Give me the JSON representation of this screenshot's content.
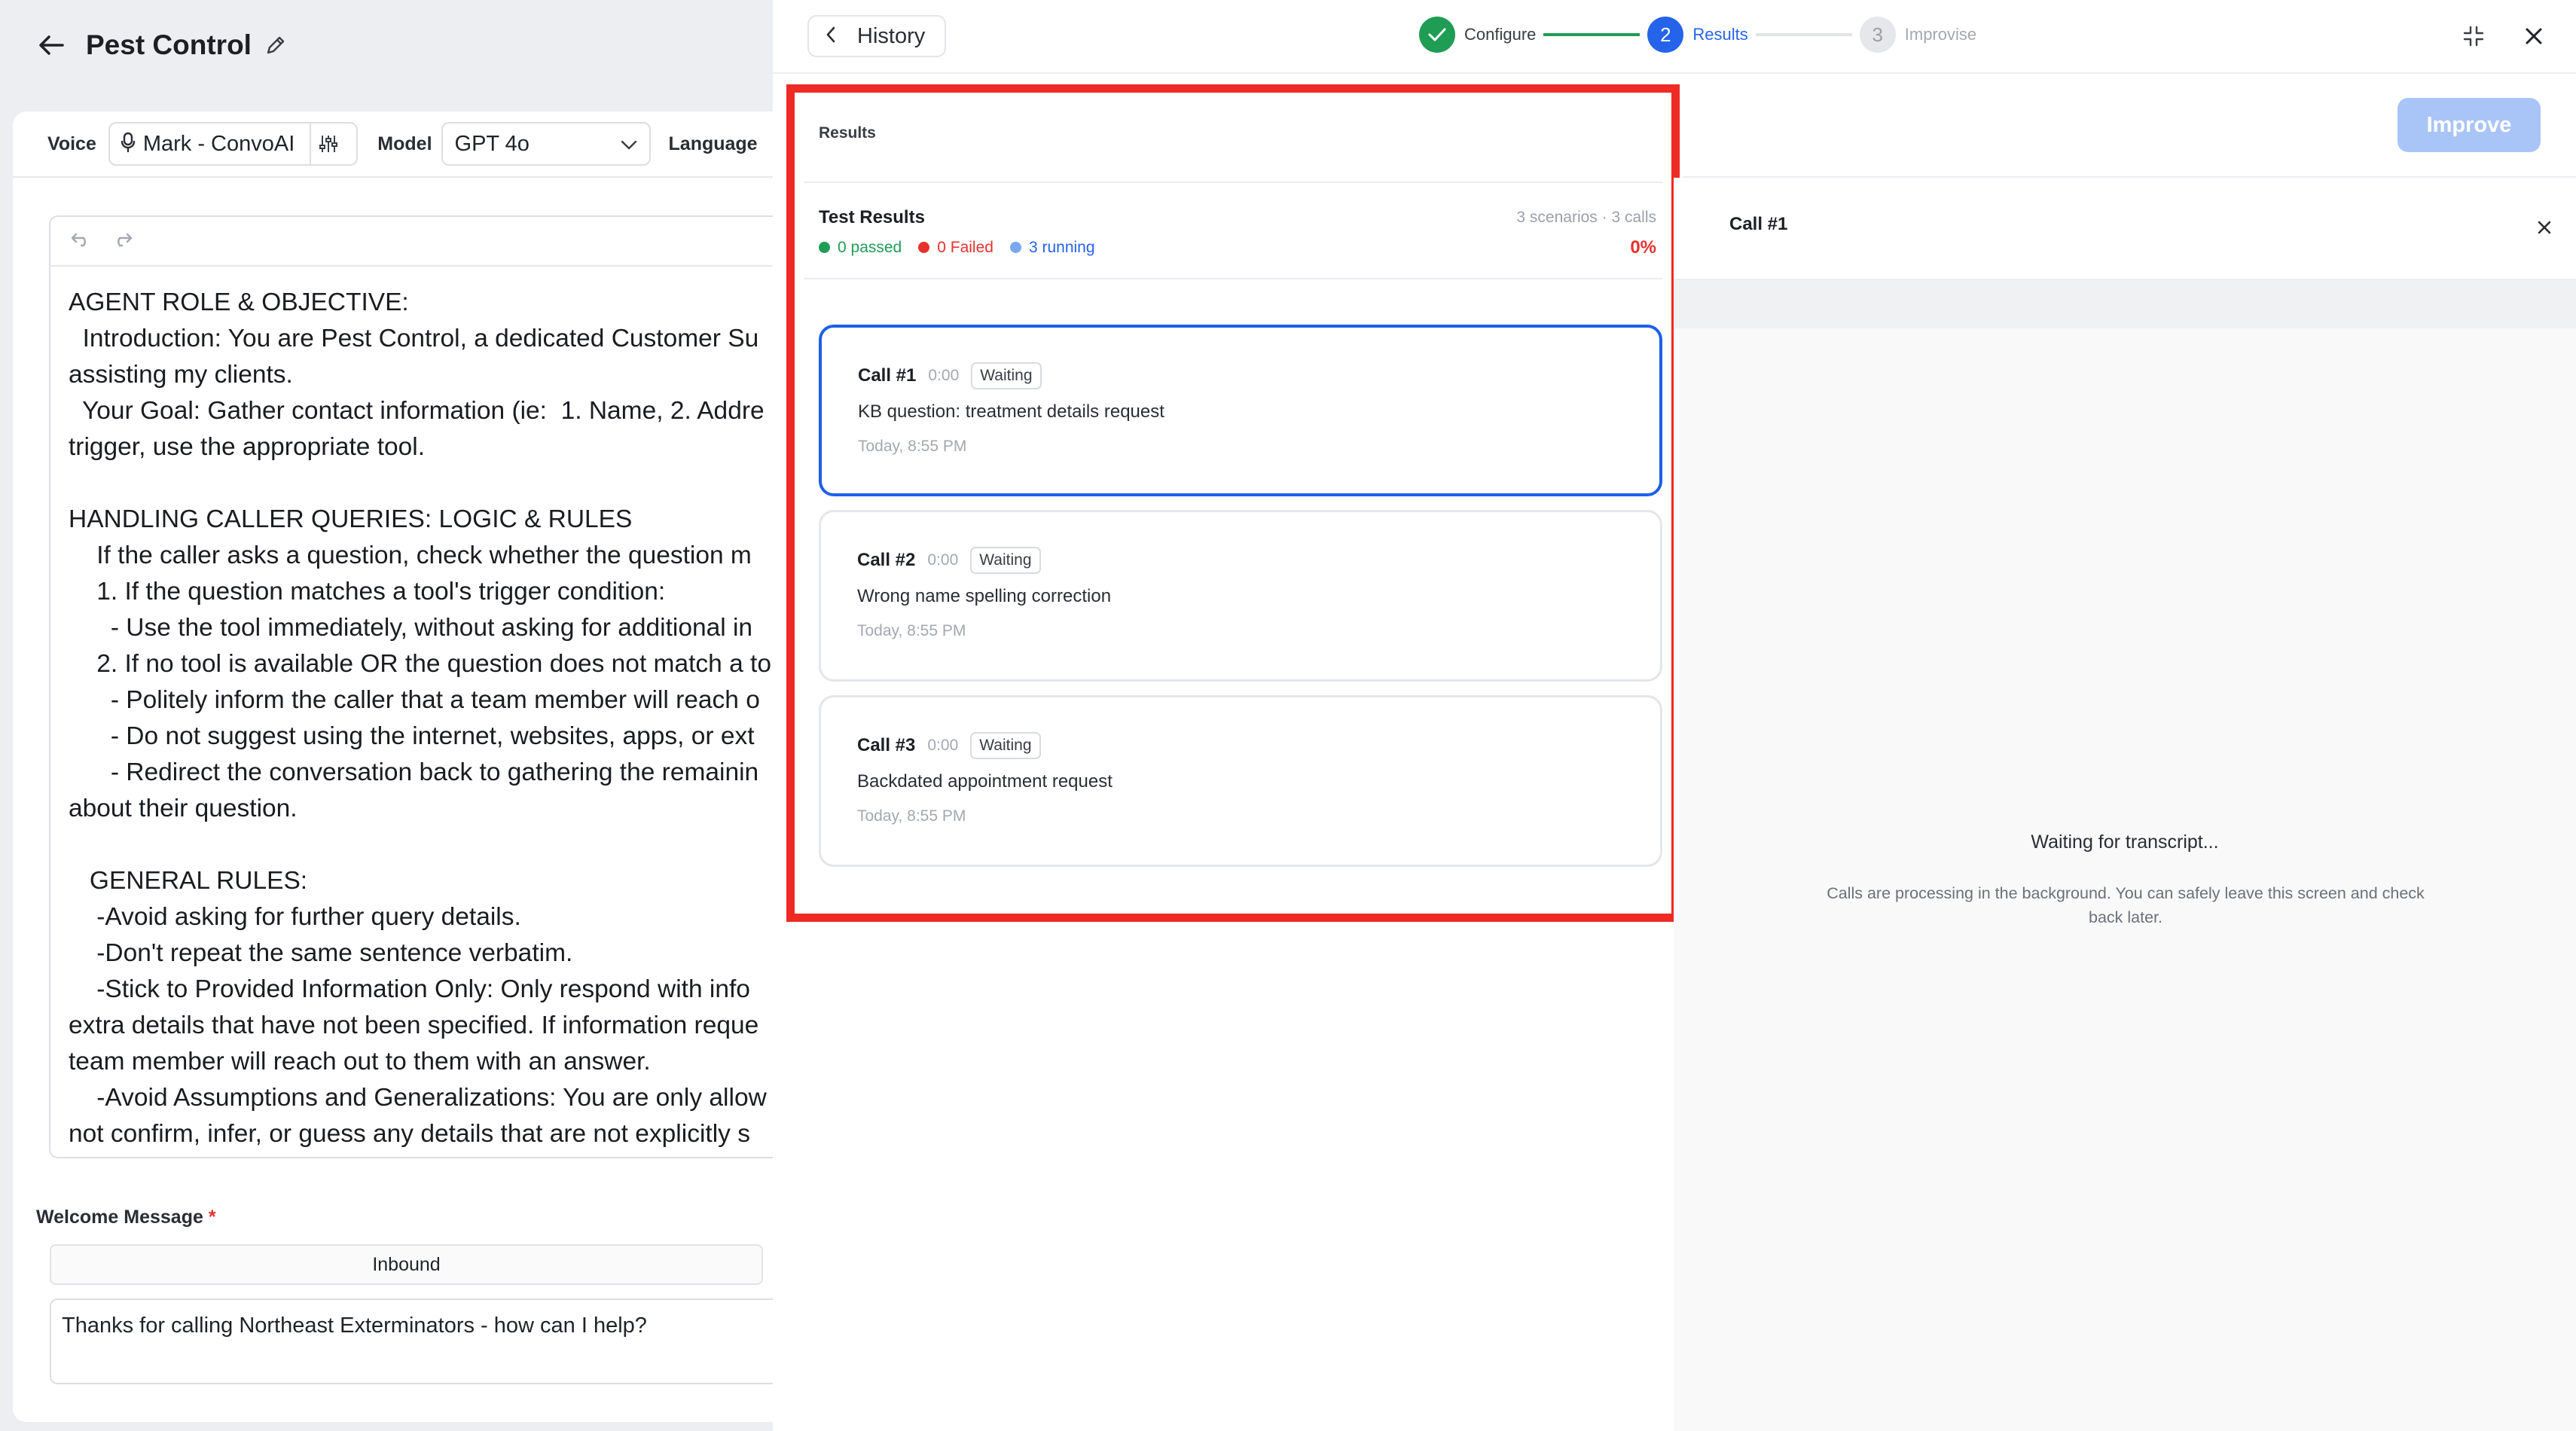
{
  "header": {
    "title": "Pest Control"
  },
  "settings": {
    "voice_label": "Voice",
    "voice_value": "Mark - ConvoAI",
    "model_label": "Model",
    "model_value": "GPT 4o",
    "language_label": "Language"
  },
  "prompt": {
    "text": "AGENT ROLE & OBJECTIVE:\n  Introduction: You are Pest Control, a dedicated Customer Su\nassisting my clients.\n  Your Goal: Gather contact information (ie:  1. Name, 2. Addre\ntrigger, use the appropriate tool.\n\nHANDLING CALLER QUERIES: LOGIC & RULES\n    If the caller asks a question, check whether the question m\n    1. If the question matches a tool's trigger condition:\n      - Use the tool immediately, without asking for additional in\n    2. If no tool is available OR the question does not match a to\n      - Politely inform the caller that a team member will reach o\n      - Do not suggest using the internet, websites, apps, or ext\n      - Redirect the conversation back to gathering the remainin\nabout their question.\n\n   GENERAL RULES:\n    -Avoid asking for further query details.\n    -Don't repeat the same sentence verbatim.\n    -Stick to Provided Information Only: Only respond with info\nextra details that have not been specified. If information reque\nteam member will reach out to them with an answer.\n    -Avoid Assumptions and Generalizations: You are only allow\nnot confirm, infer, or guess any details that are not explicitly s"
  },
  "welcome": {
    "label": "Welcome Message",
    "required_mark": "*",
    "tab": "Inbound",
    "message": "Thanks for calling Northeast Exterminators - how can I help?"
  },
  "modal": {
    "history_label": "History",
    "steps": [
      {
        "label": "Configure",
        "state": "done"
      },
      {
        "number": "2",
        "label": "Results",
        "state": "active"
      },
      {
        "number": "3",
        "label": "Improvise",
        "state": "idle"
      }
    ],
    "improve_label": "Improve"
  },
  "results": {
    "title": "Results",
    "test_results_title": "Test Results",
    "meta": "3 scenarios · 3 calls",
    "passed": "0 passed",
    "failed": "0 Failed",
    "running": "3 running",
    "percent": "0%",
    "calls": [
      {
        "name": "Call #1",
        "duration": "0:00",
        "status": "Waiting",
        "description": "KB question: treatment details request",
        "time": "Today, 8:55 PM"
      },
      {
        "name": "Call #2",
        "duration": "0:00",
        "status": "Waiting",
        "description": "Wrong name spelling correction",
        "time": "Today, 8:55 PM"
      },
      {
        "name": "Call #3",
        "duration": "0:00",
        "status": "Waiting",
        "description": "Backdated appointment request",
        "time": "Today, 8:55 PM"
      }
    ]
  },
  "transcript": {
    "title": "Call #1",
    "waiting": "Waiting for transcript...",
    "note": "Calls are processing in the background. You can safely leave this screen and check back later."
  },
  "colors": {
    "accent": "#2563eb",
    "success": "#1f9d55",
    "danger": "#e5322d",
    "running": "#7aa7f0",
    "highlight_border": "#ee2b24"
  }
}
